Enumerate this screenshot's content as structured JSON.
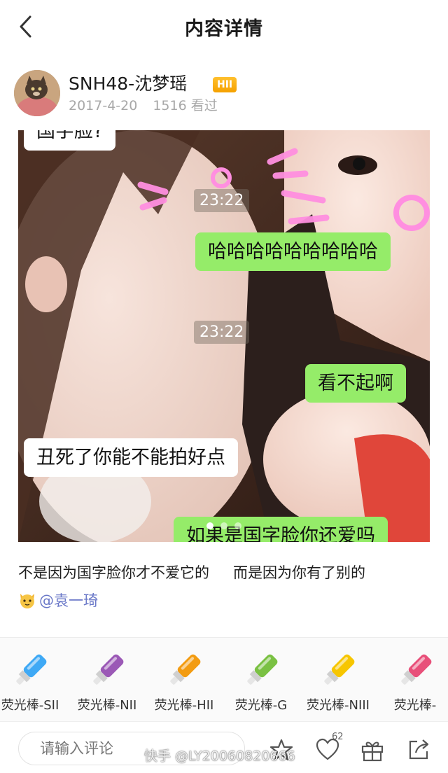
{
  "header": {
    "title": "内容详情"
  },
  "post": {
    "username": "SNH48-沈梦瑶",
    "badge": "HII",
    "date": "2017-4-20",
    "views": "1516 看过"
  },
  "photo": {
    "messages": [
      {
        "type": "received",
        "text": "国字脸?"
      },
      {
        "type": "timestamp",
        "text": "23:22"
      },
      {
        "type": "sent",
        "text": "哈哈哈哈哈哈哈哈哈"
      },
      {
        "type": "timestamp",
        "text": "23:22"
      },
      {
        "type": "sent",
        "text": "看不起啊"
      },
      {
        "type": "received",
        "text": "丑死了你能不能拍好点"
      },
      {
        "type": "sent",
        "text": "如果是国字脸你还爱吗"
      }
    ],
    "pager": {
      "total": 3,
      "current": 1
    }
  },
  "caption": {
    "part1": "不是因为国字脸你才不爱它的",
    "part2": "而是因为你有了别的",
    "emoji": "cat-face-icon",
    "mention": "@袁一琦"
  },
  "gifts": [
    {
      "label": "荧光棒-SII",
      "color": "#3fa9f5",
      "icon": "glow-stick-icon"
    },
    {
      "label": "荧光棒-NII",
      "color": "#9b59b6",
      "icon": "glow-stick-icon"
    },
    {
      "label": "荧光棒-HII",
      "color": "#f39c12",
      "icon": "glow-stick-icon"
    },
    {
      "label": "荧光棒-G",
      "color": "#7ac143",
      "icon": "glow-stick-icon"
    },
    {
      "label": "荧光棒-NIII",
      "color": "#f7c600",
      "icon": "glow-stick-icon"
    },
    {
      "label": "荧光棒-",
      "color": "#e8507a",
      "icon": "glow-stick-icon"
    }
  ],
  "bottom": {
    "comment_placeholder": "请输入评论",
    "like_count": "62",
    "watermark": "快手 @LY20060820666"
  },
  "colors": {
    "badge": "#f5a100",
    "mention": "#6a78c8",
    "bubble_sent": "#95ec69"
  }
}
